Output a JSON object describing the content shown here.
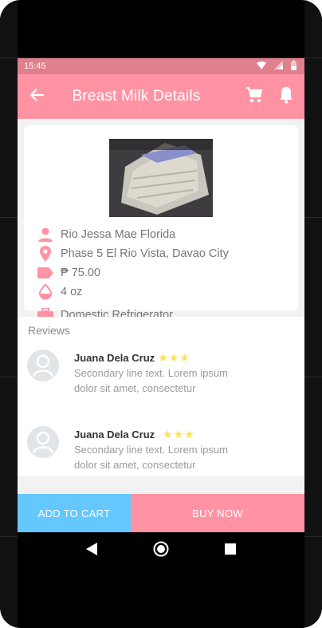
{
  "status_bar": {
    "time": "15:45",
    "icons": [
      "wifi-icon",
      "signal-icon",
      "battery-icon"
    ]
  },
  "app_bar": {
    "title": "Breast Milk Details",
    "icons": [
      "back-arrow-icon",
      "cart-icon",
      "bell-icon"
    ]
  },
  "product": {
    "seller": "Rio Jessa Mae Florida",
    "location": "Phase 5 El Rio Vista, Davao City",
    "price": "₱ 75.00",
    "volume": "4 oz",
    "storage": "Domestic Refrigerator",
    "icons": [
      "person-icon",
      "location-pin-icon",
      "price-tag-icon",
      "drop-icon",
      "briefcase-icon"
    ]
  },
  "reviews": {
    "title": "Reviews",
    "items": [
      {
        "name": "Juana Dela Cruz",
        "stars": "★★★",
        "rating": 3,
        "line1": "Secondary line text. Lorem ipsum",
        "line2": "dolor sit amet, consectetur"
      },
      {
        "name": "Juana Dela Cruz",
        "stars": "★★★",
        "rating": 3,
        "line1": "Secondary line text. Lorem ipsum",
        "line2": "dolor sit amet, consectetur"
      }
    ]
  },
  "actions": {
    "add_to_cart": "ADD TO CART",
    "buy_now": "BUY NOW"
  },
  "colors": {
    "primary": "#ff93a4",
    "status_bar": "#e07f8d",
    "accent_blue": "#64c8ff",
    "star": "#ffe14d"
  },
  "nav_bar": {
    "icons": [
      "back-triangle-icon",
      "home-circle-icon",
      "recents-square-icon"
    ]
  }
}
